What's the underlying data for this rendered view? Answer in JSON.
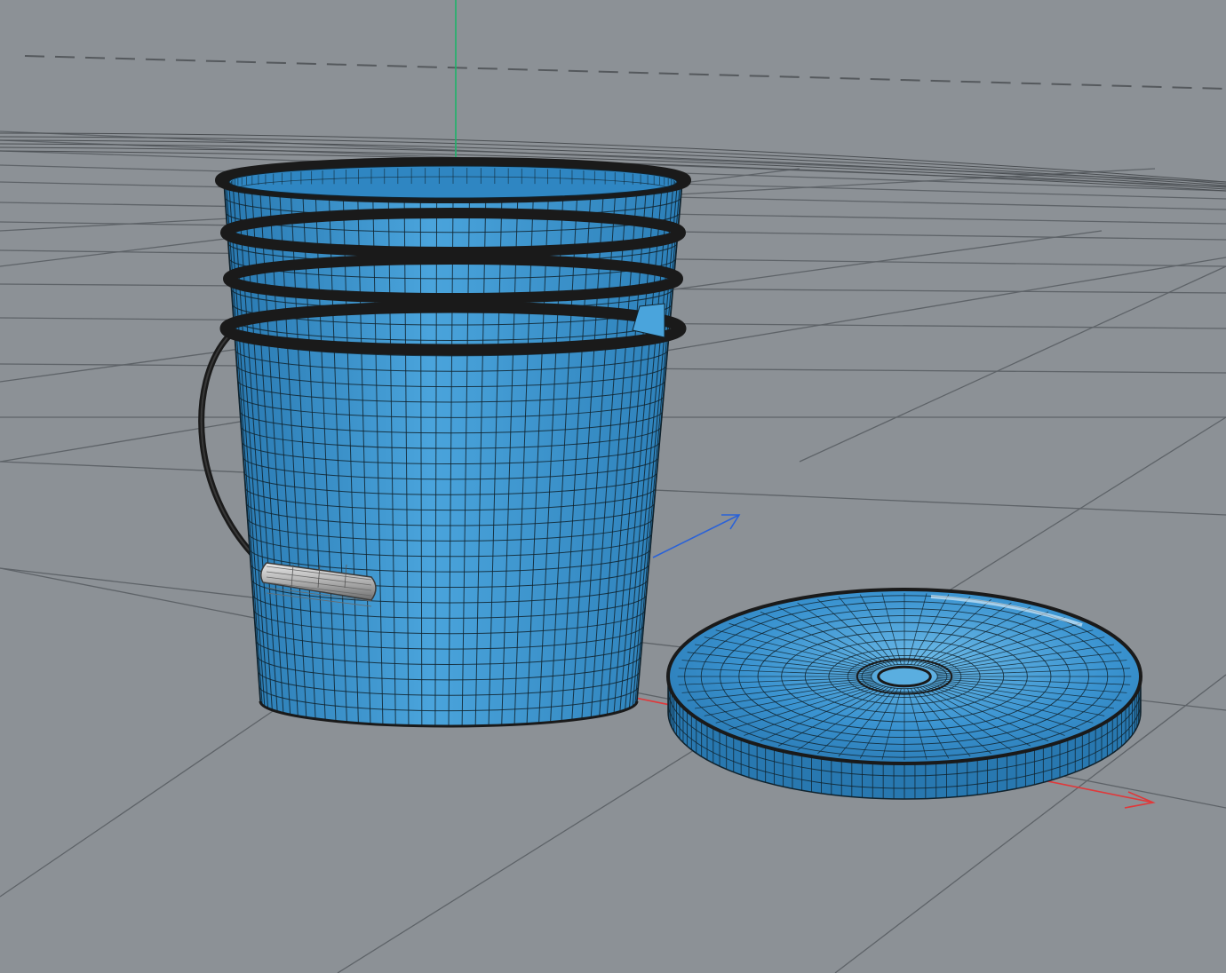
{
  "viewport": {
    "mode": "perspective-3d",
    "display": "shaded-wireframe",
    "background_color": "#8c9196"
  },
  "colors": {
    "grid_line": "#5e6368",
    "grid_major": "#4a4e52",
    "horizon_dashed": "#55595d",
    "mesh_fill": "#3a93d0",
    "mesh_fill_light": "#5aaee0",
    "mesh_fill_dark": "#2878b0",
    "wire": "#10232e",
    "rim": "#1a1a1a",
    "handle_grip": "#bdbdbd",
    "axis_x": "#e0383a",
    "axis_y": "#1fb36a",
    "axis_z": "#2a62d8"
  },
  "scene": {
    "objects": [
      {
        "name": "bucket",
        "icon": "mesh-object-icon"
      },
      {
        "name": "bucket-handle",
        "icon": "mesh-object-icon"
      },
      {
        "name": "bucket-lid",
        "icon": "mesh-object-icon"
      }
    ],
    "axes": [
      "x-axis",
      "y-axis",
      "z-axis"
    ]
  }
}
